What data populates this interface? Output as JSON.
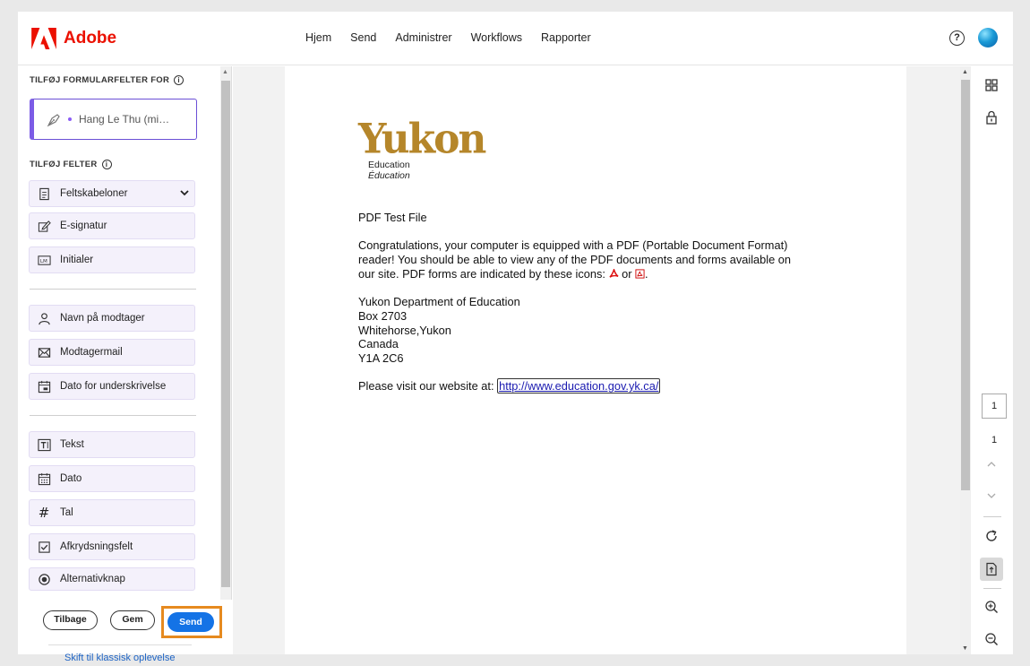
{
  "header": {
    "brand": "Adobe",
    "nav": [
      "Hjem",
      "Send",
      "Administrer",
      "Workflows",
      "Rapporter"
    ],
    "help_label": "?"
  },
  "left_panel": {
    "form_fields_for_title": "TILFØJ FORMULARFELTER FOR",
    "signer_name": "Hang Le Thu (mi…",
    "add_fields_title": "TILFØJ FELTER",
    "info_label": "i",
    "groups": [
      [
        {
          "label": "Feltskabeloner",
          "icon": "template-icon"
        },
        {
          "label": "E-signatur",
          "icon": "signature-icon"
        },
        {
          "label": "Initialer",
          "icon": "initials-icon"
        }
      ],
      [
        {
          "label": "Navn på modtager",
          "icon": "person-icon"
        },
        {
          "label": "Modtagermail",
          "icon": "mail-icon"
        },
        {
          "label": "Dato for underskrivelse",
          "icon": "calendar-sign-icon"
        }
      ],
      [
        {
          "label": "Tekst",
          "icon": "text-icon"
        },
        {
          "label": "Dato",
          "icon": "calendar-icon"
        },
        {
          "label": "Tal",
          "icon": "number-icon"
        },
        {
          "label": "Afkrydsningsfelt",
          "icon": "checkbox-icon"
        },
        {
          "label": "Alternativknap",
          "icon": "radio-icon"
        }
      ]
    ],
    "buttons": {
      "back": "Tilbage",
      "save": "Gem",
      "send": "Send"
    },
    "classic_link": "Skift til klassisk oplevelse"
  },
  "document": {
    "logo_word": "Yukon",
    "logo_sub1": "Education",
    "logo_sub2": "Éducation",
    "heading": "PDF Test File",
    "para_line1": "Congratulations, your computer is equipped with a PDF (Portable Document Format)",
    "para_line2": "reader!  You should be able to view any of the PDF documents and forms available on",
    "para_line3a": "our site.  PDF forms are indicated by these icons:",
    "para_line3b": "or",
    "address": [
      "Yukon Department of Education",
      "Box 2703",
      "Whitehorse,Yukon",
      "Canada",
      "Y1A 2C6"
    ],
    "visit_text": "Please visit our website at:",
    "link": "http://www.education.gov.yk.ca/"
  },
  "rail": {
    "current_page": "1",
    "total_pages": "1"
  },
  "colors": {
    "brand_red": "#eb1000",
    "send_blue": "#1473e6",
    "highlight_orange": "#e68a1f",
    "signer_purple": "#7c5ce6",
    "yukon_gold": "#b5862a"
  }
}
